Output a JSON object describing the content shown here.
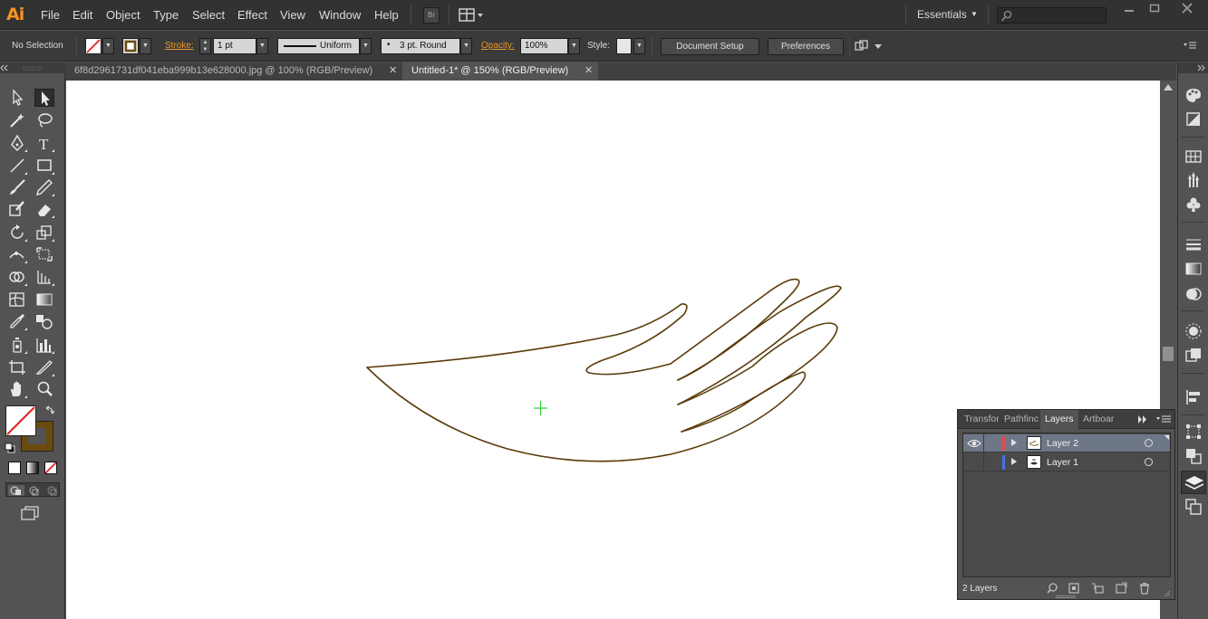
{
  "app": {
    "logo": "Ai"
  },
  "menu": {
    "items": [
      "File",
      "Edit",
      "Object",
      "Type",
      "Select",
      "Effect",
      "View",
      "Window",
      "Help"
    ],
    "bridge_label": "Br",
    "workspace": "Essentials"
  },
  "control_bar": {
    "selection": "No Selection",
    "stroke_label": "Stroke:",
    "stroke_weight": "1 pt",
    "profile": "Uniform",
    "brush": "3 pt. Round",
    "opacity_label": "Opacity:",
    "opacity": "100%",
    "style_label": "Style:",
    "document_setup": "Document Setup",
    "preferences": "Preferences"
  },
  "tabs": [
    {
      "label": "6f8d2961731df041eba999b13e628000.jpg @ 100% (RGB/Preview)",
      "active": false
    },
    {
      "label": "Untitled-1* @ 150% (RGB/Preview)",
      "active": true
    }
  ],
  "colors": {
    "stroke": "#5a3c0a",
    "artboard": "#ffffff",
    "cursor": "#33cc33",
    "layer2_color": "#e8484a",
    "layer1_color": "#4a6fe8"
  },
  "layers_panel": {
    "tabs": [
      "Transfor",
      "Pathfinc",
      "Layers",
      "Artboar"
    ],
    "active_tab": "Layers",
    "layers": [
      {
        "name": "Layer 2",
        "visible": true,
        "selected": true
      },
      {
        "name": "Layer 1",
        "visible": false,
        "selected": false
      }
    ],
    "count": "2 Layers"
  }
}
